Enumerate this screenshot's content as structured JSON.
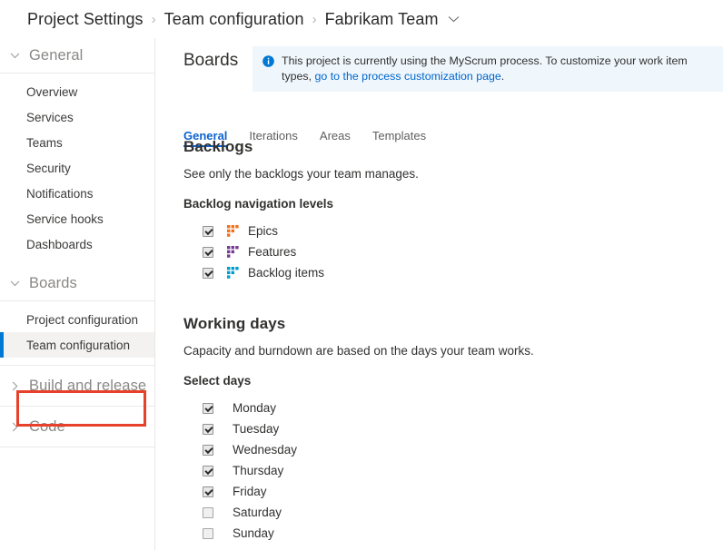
{
  "breadcrumb": {
    "separator": "›",
    "items": [
      {
        "label": "Project Settings"
      },
      {
        "label": "Team configuration"
      },
      {
        "label": "Fabrikam Team"
      }
    ],
    "chevron_icon": "chevron-down-icon"
  },
  "sidebar": {
    "groups": [
      {
        "label": "General",
        "expanded": true,
        "chevron_icon": "chevron-down-icon",
        "items": [
          {
            "label": "Overview",
            "selected": false
          },
          {
            "label": "Services",
            "selected": false
          },
          {
            "label": "Teams",
            "selected": false
          },
          {
            "label": "Security",
            "selected": false
          },
          {
            "label": "Notifications",
            "selected": false
          },
          {
            "label": "Service hooks",
            "selected": false
          },
          {
            "label": "Dashboards",
            "selected": false
          }
        ]
      },
      {
        "label": "Boards",
        "expanded": true,
        "chevron_icon": "chevron-down-icon",
        "items": [
          {
            "label": "Project configuration",
            "selected": false
          },
          {
            "label": "Team configuration",
            "selected": true
          }
        ]
      },
      {
        "label": "Build and release",
        "expanded": false,
        "chevron_icon": "chevron-right-icon",
        "items": []
      },
      {
        "label": "Code",
        "expanded": false,
        "chevron_icon": "chevron-right-icon",
        "items": []
      }
    ]
  },
  "main": {
    "page_title": "Boards",
    "info_bar": {
      "icon": "info-circle-icon",
      "text_before": "This project is currently using the MyScrum process. To customize your work item types, ",
      "link_text": "go to the process customization page",
      "text_after": "."
    },
    "tabs": [
      {
        "label": "General",
        "active": true
      },
      {
        "label": "Iterations",
        "active": false
      },
      {
        "label": "Areas",
        "active": false
      },
      {
        "label": "Templates",
        "active": false
      }
    ],
    "backlogs": {
      "title": "Backlogs",
      "description": "See only the backlogs your team manages.",
      "subtitle": "Backlog navigation levels",
      "levels": [
        {
          "label": "Epics",
          "checked": true,
          "icon": "backlog-level-icon",
          "color": "#f2711c"
        },
        {
          "label": "Features",
          "checked": true,
          "icon": "backlog-level-icon",
          "color": "#773b93"
        },
        {
          "label": "Backlog items",
          "checked": true,
          "icon": "backlog-level-icon",
          "color": "#009ccc"
        }
      ]
    },
    "working_days": {
      "title": "Working days",
      "description": "Capacity and burndown are based on the days your team works.",
      "subtitle": "Select days",
      "days": [
        {
          "label": "Monday",
          "checked": true
        },
        {
          "label": "Tuesday",
          "checked": true
        },
        {
          "label": "Wednesday",
          "checked": true
        },
        {
          "label": "Thursday",
          "checked": true
        },
        {
          "label": "Friday",
          "checked": true
        },
        {
          "label": "Saturday",
          "checked": false
        },
        {
          "label": "Sunday",
          "checked": false
        }
      ]
    }
  },
  "annotation": {
    "type": "highlight-rectangle",
    "color": "#e8412b",
    "target": "Team configuration"
  },
  "colors": {
    "accent": "#0078d4",
    "tab_active": "#0b63ce",
    "info_bg": "#eff6fc",
    "selected_bg": "#f3f2f1",
    "annotation": "#e8412b"
  }
}
